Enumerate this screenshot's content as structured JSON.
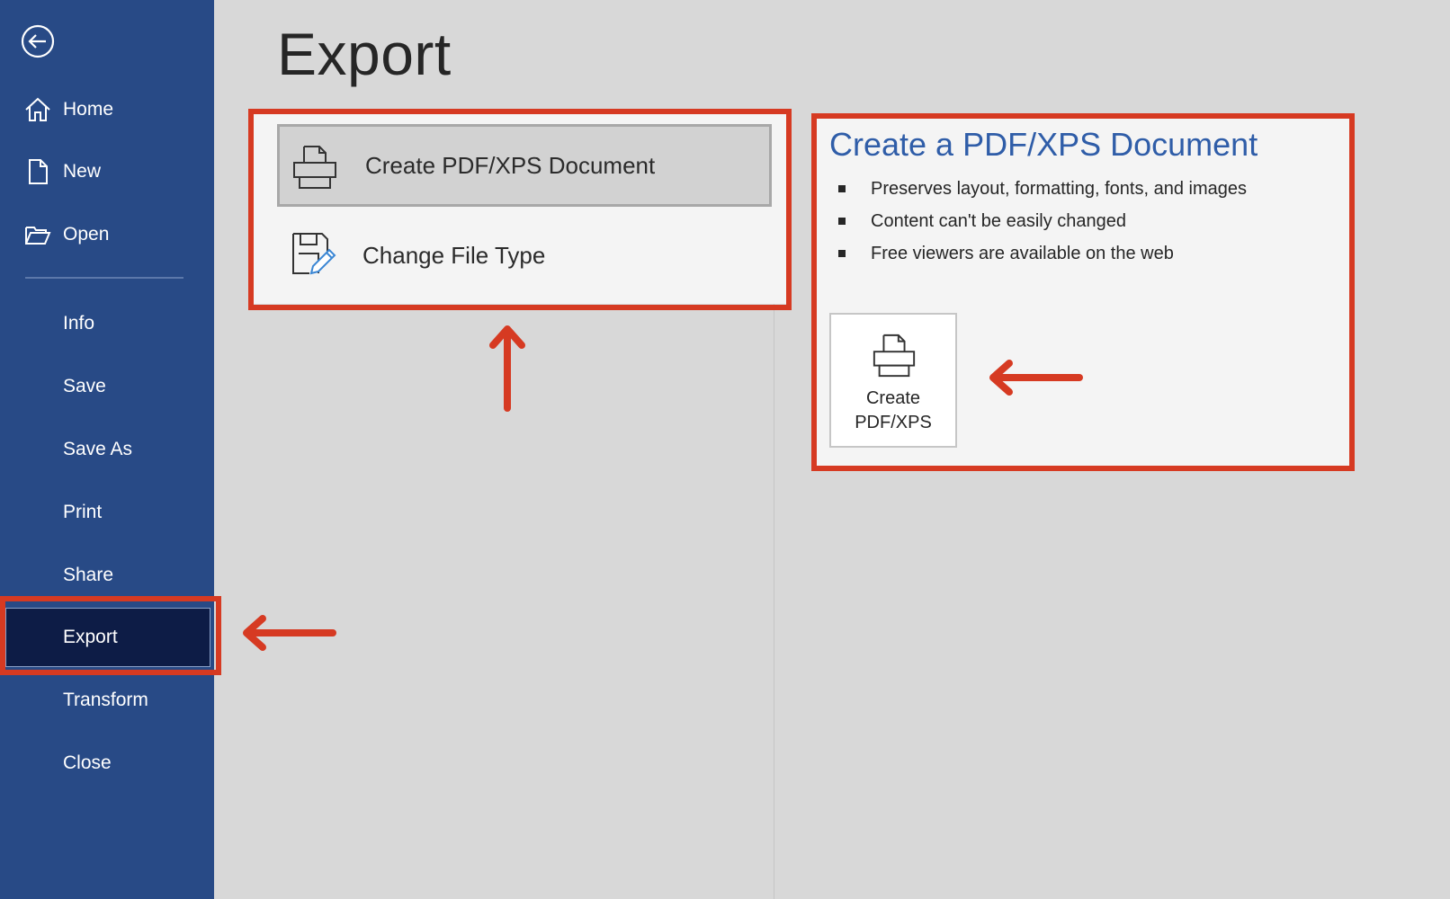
{
  "sidebar": {
    "back_icon": "arrow-left-circle-icon",
    "top_items": [
      {
        "label": "Home",
        "icon": "home-icon"
      },
      {
        "label": "New",
        "icon": "new-document-icon"
      },
      {
        "label": "Open",
        "icon": "folder-open-icon"
      }
    ],
    "items": [
      "Info",
      "Save",
      "Save As",
      "Print",
      "Share",
      "Export",
      "Transform",
      "Close"
    ],
    "selected": "Export"
  },
  "main": {
    "title": "Export",
    "options": [
      {
        "label": "Create PDF/XPS Document",
        "icon": "printer-pdf-icon",
        "active": true
      },
      {
        "label": "Change File Type",
        "icon": "change-file-type-icon",
        "active": false
      }
    ]
  },
  "detail": {
    "title": "Create a PDF/XPS Document",
    "bullets": [
      "Preserves layout, formatting, fonts, and images",
      "Content can't be easily changed",
      "Free viewers are available on the web"
    ],
    "button": {
      "line1": "Create",
      "line2": "PDF/XPS",
      "icon": "printer-pdf-icon"
    }
  },
  "colors": {
    "sidebar_bg": "#284a86",
    "sidebar_selected": "#0d1c46",
    "accent_title": "#2f5da8",
    "annotation_red": "#d63a22"
  }
}
